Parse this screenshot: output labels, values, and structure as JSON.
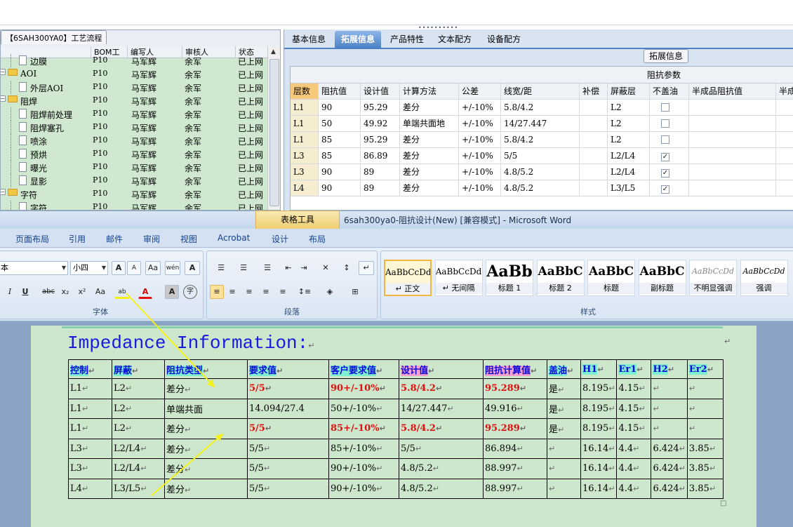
{
  "left_panel": {
    "title": "【6SAH300YA0】工艺流程",
    "columns": [
      "BOM工厂",
      "编写人",
      "审核人",
      "状态"
    ],
    "rows": [
      {
        "name": "边膜",
        "type": "doc",
        "level": 2,
        "bom": "P10",
        "author": "马军辉",
        "reviewer": "余军",
        "status": "已上网"
      },
      {
        "name": "AOI",
        "type": "folder",
        "level": 1,
        "bom": "P10",
        "author": "马军辉",
        "reviewer": "余军",
        "status": "已上网"
      },
      {
        "name": "外层AOI",
        "type": "doc",
        "level": 2,
        "bom": "P10",
        "author": "马军辉",
        "reviewer": "余军",
        "status": "已上网"
      },
      {
        "name": "阻焊",
        "type": "folder",
        "level": 1,
        "bom": "P10",
        "author": "马军辉",
        "reviewer": "余军",
        "status": "已上网"
      },
      {
        "name": "阻焊前处理",
        "type": "doc",
        "level": 2,
        "bom": "P10",
        "author": "马军辉",
        "reviewer": "余军",
        "status": "已上网"
      },
      {
        "name": "阻焊塞孔",
        "type": "doc",
        "level": 2,
        "bom": "P10",
        "author": "马军辉",
        "reviewer": "余军",
        "status": "已上网"
      },
      {
        "name": "喷涂",
        "type": "doc",
        "level": 2,
        "bom": "P10",
        "author": "马军辉",
        "reviewer": "余军",
        "status": "已上网"
      },
      {
        "name": "预烘",
        "type": "doc",
        "level": 2,
        "bom": "P10",
        "author": "马军辉",
        "reviewer": "余军",
        "status": "已上网"
      },
      {
        "name": "曝光",
        "type": "doc",
        "level": 2,
        "bom": "P10",
        "author": "马军辉",
        "reviewer": "余军",
        "status": "已上网"
      },
      {
        "name": "显影",
        "type": "doc",
        "level": 2,
        "bom": "P10",
        "author": "马军辉",
        "reviewer": "余军",
        "status": "已上网"
      },
      {
        "name": "字符",
        "type": "folder",
        "level": 1,
        "bom": "P10",
        "author": "马军辉",
        "reviewer": "余军",
        "status": "已上网"
      },
      {
        "name": "字符",
        "type": "doc",
        "level": 2,
        "bom": "P10",
        "author": "马军辉",
        "reviewer": "余军",
        "status": "已上网"
      }
    ],
    "expander_symbol": "−"
  },
  "right_panel": {
    "tabs": [
      "基本信息",
      "拓展信息",
      "产品特性",
      "文本配方",
      "设备配方"
    ],
    "active_tab": 1,
    "subtab_button": "拓展信息",
    "group_header": "阻抗参数",
    "columns": [
      "层数",
      "阻抗值",
      "设计值",
      "计算方法",
      "公差",
      "线宽/距",
      "补偿",
      "屏蔽层",
      "不盖油",
      "半成品阻抗值",
      "半成"
    ],
    "rows": [
      {
        "layer": "L1",
        "impedance": "90",
        "design": "95.29",
        "method": "差分",
        "tolerance": "+/-10%",
        "width": "5.8/4.2",
        "comp": "",
        "shield": "L2",
        "no_mask": false
      },
      {
        "layer": "L1",
        "impedance": "50",
        "design": "49.92",
        "method": "单端共面地",
        "tolerance": "+/-10%",
        "width": "14/27.447",
        "comp": "",
        "shield": "L2",
        "no_mask": false
      },
      {
        "layer": "L1",
        "impedance": "85",
        "design": "95.29",
        "method": "差分",
        "tolerance": "+/-10%",
        "width": "5.8/4.2",
        "comp": "",
        "shield": "L2",
        "no_mask": false
      },
      {
        "layer": "L3",
        "impedance": "85",
        "design": "86.89",
        "method": "差分",
        "tolerance": "+/-10%",
        "width": "5/5",
        "comp": "",
        "shield": "L2/L4",
        "no_mask": true
      },
      {
        "layer": "L3",
        "impedance": "90",
        "design": "89",
        "method": "差分",
        "tolerance": "+/-10%",
        "width": "4.8/5.2",
        "comp": "",
        "shield": "L2/L4",
        "no_mask": true
      },
      {
        "layer": "L4",
        "impedance": "90",
        "design": "89",
        "method": "差分",
        "tolerance": "+/-10%",
        "width": "4.8/5.2",
        "comp": "",
        "shield": "L3/L5",
        "no_mask": true
      }
    ],
    "check_mark": "✓"
  },
  "word": {
    "context_tab": "表格工具",
    "title": "6sah300ya0-阻抗设计(New) [兼容模式] - Microsoft Word",
    "ribbon_tabs": [
      "页面布局",
      "引用",
      "邮件",
      "审阅",
      "视图",
      "Acrobat",
      "设计",
      "布局"
    ],
    "font_name": "本",
    "font_size": "小四",
    "groups": {
      "font": "字体",
      "paragraph": "段落",
      "styles": "样式"
    },
    "font_buttons": {
      "grow": "A",
      "shrink": "A",
      "clear": "Aa",
      "wen": "wén",
      "border_a": "A",
      "italic": "I",
      "underline": "U",
      "strike": "abc",
      "sub": "x₂",
      "sup": "x²",
      "case": "Aa",
      "highlight": "ab",
      "fontcolor": "A",
      "shade_a": "A",
      "circle": "字"
    },
    "para_buttons": {
      "bullets": "☰",
      "numbering": "☰",
      "multilevel": "☰",
      "dec_indent": "⇤",
      "inc_indent": "⇥",
      "asian": "✕",
      "sort": "↕",
      "marks": "↵"
    },
    "styles": [
      {
        "sample": "AaBbCcDd",
        "name": "↵ 正文",
        "size": 12,
        "active": true
      },
      {
        "sample": "AaBbCcDd",
        "name": "↵ 无间隔",
        "size": 12,
        "active": false
      },
      {
        "sample": "AaBb",
        "name": "标题 1",
        "size": 22,
        "active": false
      },
      {
        "sample": "AaBbC",
        "name": "标题 2",
        "size": 17,
        "active": false
      },
      {
        "sample": "AaBbC",
        "name": "标题",
        "size": 17,
        "active": false
      },
      {
        "sample": "AaBbC",
        "name": "副标题",
        "size": 17,
        "active": false
      },
      {
        "sample": "AaBbCcDd",
        "name": "不明显强调",
        "size": 11,
        "active": false
      },
      {
        "sample": "AaBbCcDd",
        "name": "强调",
        "size": 11,
        "active": false
      }
    ]
  },
  "document": {
    "title": "Impedance Information:",
    "para_mark": "↵",
    "headers": [
      "控制",
      "屏蔽",
      "阻抗类型",
      "要求值",
      "客户要求值",
      "设计值",
      "阻抗计算值",
      "盖油",
      "H1",
      "Er1",
      "H2",
      "Er2"
    ],
    "rows": [
      [
        "L1",
        "L2",
        "差分",
        "5/5",
        "90+/-10%",
        "5.8/4.2",
        "95.289",
        "是",
        "8.195",
        "4.15",
        "",
        ""
      ],
      [
        "L1",
        "L2",
        "单端共面",
        "14.094/27.4",
        "50+/-10%",
        "14/27.447",
        "49.916",
        "是",
        "8.195",
        "4.15",
        "",
        ""
      ],
      [
        "L1",
        "L2",
        "差分",
        "5/5",
        "85+/-10%",
        "5.8/4.2",
        "95.289",
        "是",
        "8.195",
        "4.15",
        "",
        ""
      ],
      [
        "L3",
        "L2/L4",
        "差分",
        "5/5",
        "85+/-10%",
        "5/5",
        "86.894",
        "",
        "16.14",
        "4.4",
        "6.424",
        "3.85"
      ],
      [
        "L3",
        "L2/L4",
        "差分",
        "5/5",
        "90+/-10%",
        "4.8/5.2",
        "88.997",
        "",
        "16.14",
        "4.4",
        "6.424",
        "3.85"
      ],
      [
        "L4",
        "L3/L5",
        "差分",
        "5/5",
        "90+/-10%",
        "4.8/5.2",
        "88.997",
        "",
        "16.14",
        "4.4",
        "6.424",
        "3.85"
      ]
    ],
    "colors": {
      "title": "#1a1adf",
      "header_text": "#0a0ad8",
      "highlight_red": "#e01010",
      "arrow": "#f4f01a"
    }
  }
}
